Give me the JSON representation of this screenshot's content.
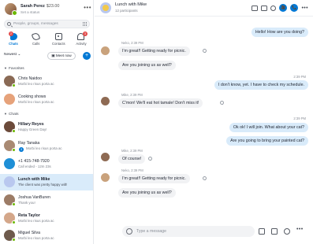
{
  "profile": {
    "name": "Sarah Perez",
    "credit": "$23.00",
    "status": "Set a status",
    "more_glyph": "•••"
  },
  "search": {
    "placeholder": "People, groups, messages"
  },
  "nav": [
    {
      "label": "Chats",
      "icon": "chat-icon",
      "badge": "2",
      "active": true
    },
    {
      "label": "Calls",
      "icon": "phone-icon"
    },
    {
      "label": "Contacts",
      "icon": "contacts-icon"
    },
    {
      "label": "Activity",
      "icon": "bell-icon",
      "badge": "3"
    }
  ],
  "sort": {
    "label": "Newest ⌄",
    "meet_now": "▣ Meet now",
    "new_chat": "+"
  },
  "sections": {
    "favorites": "Favorites",
    "chats": "Chats",
    "caret": "▼"
  },
  "favorites": [
    {
      "title": "Chris Naidoo",
      "subtitle": "Morbi leo risus porta ac",
      "color": "#8a6a55"
    },
    {
      "title": "Cooking shows",
      "subtitle": "Morbi leo risus porta ac",
      "color": "#e6a27a"
    }
  ],
  "chats": [
    {
      "title": "Hillary Reyes",
      "subtitle": "Happy Green Day!",
      "bold": true,
      "count": "3",
      "color": "#6b4a3a"
    },
    {
      "title": "Ray Tanaka",
      "subtitle": "Morbi leo risus porta ac",
      "color": "#a98a73"
    },
    {
      "title": "+1 415-748-7920",
      "subtitle": "Call ended - 12m 23s",
      "color": "#1e8fd6"
    },
    {
      "title": "Lunch with Mike",
      "subtitle": "The client was pretty happy with",
      "selected": true,
      "color": "#b9c8ef"
    },
    {
      "title": "Joshua VanBuren",
      "subtitle": "Thank you!",
      "color": "#9c7c66"
    },
    {
      "title": "Reta Taylor",
      "subtitle": "Morbi leo risus porta ac",
      "bold": true,
      "color": "#d4a78a"
    },
    {
      "title": "Miguel Silva",
      "subtitle": "Morbi leo risus porta ac",
      "color": "#6e5a4c"
    }
  ],
  "header": {
    "title": "Lunch with Mike",
    "subtitle": "12 participants",
    "call_label": "📞",
    "video_label": "🎥",
    "more_glyph": "•••"
  },
  "messages": {
    "m1": "Hello! How are you doing?",
    "m2_meta": "Neko, 2:39 PM",
    "m2a": "I'm great!! Getting ready for picnic.",
    "m2b": "Are you joining us as well?",
    "m3_meta": "2:39 PM",
    "m3": "I don't know, yet. I have to check my schedule.",
    "m4_meta": "Mike, 2:39 PM",
    "m4": "C'mon! We'll eat hot tamale! Don't miss it!",
    "m5_meta": "2:39 PM",
    "m5a": "Ok ok! I will join. What about your cat?",
    "m5b": "Are you going to bring your painted cat?",
    "m6_meta": "Mike, 2:39 PM",
    "m6": "Of course!",
    "m7_meta": "Neko, 2:39 PM",
    "m7a": "I'm great!! Getting ready for picnic.",
    "m7b": "Are you joining us as well?"
  },
  "compose": {
    "placeholder": "Type a message",
    "more_glyph": "•••"
  }
}
